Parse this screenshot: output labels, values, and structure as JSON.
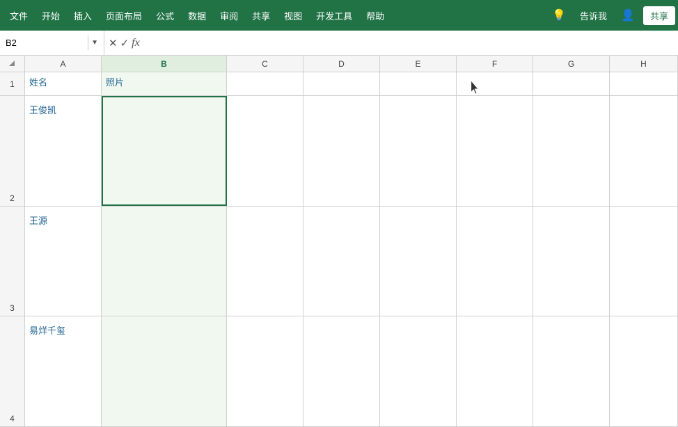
{
  "menubar": {
    "items": [
      "文件",
      "开始",
      "插入",
      "页面布局",
      "公式",
      "数据",
      "审阅",
      "共享",
      "视图",
      "开发工具",
      "帮助"
    ],
    "tell_me": "告诉我",
    "share": "共享"
  },
  "formulabar": {
    "cell_ref": "B2",
    "cancel_label": "✕",
    "confirm_label": "✓",
    "fx_label": "fx",
    "formula_value": ""
  },
  "columns": {
    "row_header": "",
    "headers": [
      "A",
      "B",
      "C",
      "D",
      "E",
      "F",
      "G",
      "H"
    ]
  },
  "rows": [
    {
      "row_num": "1",
      "cells": [
        {
          "text": "姓名",
          "col": "a",
          "style": "header"
        },
        {
          "text": "照片",
          "col": "b",
          "style": "header"
        },
        {
          "text": "",
          "col": "c"
        },
        {
          "text": "",
          "col": "d"
        },
        {
          "text": "",
          "col": "e"
        },
        {
          "text": "",
          "col": "f"
        },
        {
          "text": "",
          "col": "g"
        },
        {
          "text": "",
          "col": "h"
        }
      ]
    },
    {
      "row_num": "2",
      "cells": [
        {
          "text": "王俊凯",
          "col": "a",
          "style": "data"
        },
        {
          "text": "",
          "col": "b"
        },
        {
          "text": "",
          "col": "c"
        },
        {
          "text": "",
          "col": "d"
        },
        {
          "text": "",
          "col": "e"
        },
        {
          "text": "",
          "col": "f"
        },
        {
          "text": "",
          "col": "g"
        },
        {
          "text": "",
          "col": "h"
        }
      ]
    },
    {
      "row_num": "3",
      "cells": [
        {
          "text": "王源",
          "col": "a",
          "style": "data"
        },
        {
          "text": "",
          "col": "b"
        },
        {
          "text": "",
          "col": "c"
        },
        {
          "text": "",
          "col": "d"
        },
        {
          "text": "",
          "col": "e"
        },
        {
          "text": "",
          "col": "f"
        },
        {
          "text": "",
          "col": "g"
        },
        {
          "text": "",
          "col": "h"
        }
      ]
    },
    {
      "row_num": "4",
      "cells": [
        {
          "text": "易烊千玺",
          "col": "a",
          "style": "data"
        },
        {
          "text": "",
          "col": "b"
        },
        {
          "text": "",
          "col": "c"
        },
        {
          "text": "",
          "col": "d"
        },
        {
          "text": "",
          "col": "e"
        },
        {
          "text": "",
          "col": "f"
        },
        {
          "text": "",
          "col": "g"
        },
        {
          "text": "",
          "col": "h"
        }
      ]
    }
  ],
  "colors": {
    "excel_green": "#217346",
    "header_blue": "#1f6391",
    "grid_border": "#d0d0d0",
    "row_bg": "#f5f5f5"
  }
}
